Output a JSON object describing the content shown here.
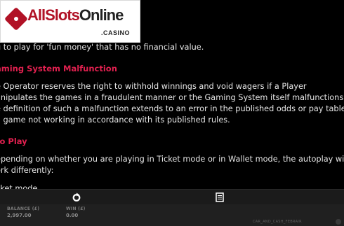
{
  "logo": {
    "text_main": "AllSlots",
    "text_accent": "Online",
    "subtitle": ".CASINO"
  },
  "content": {
    "intro_line": "u to play for 'fun money' that has no financial value.",
    "malfunction": {
      "heading": "aming System Malfunction",
      "lines": [
        "e Operator reserves the right to withhold winnings and void wagers if a Player",
        "anipulates the games in a fraudulent manner or the Gaming System itself malfunctions.",
        "e definition of such a malfunction extends to an error in the published odds or pay table",
        "a game not working in accordance with its published rules."
      ]
    },
    "autoplay": {
      "heading": "to Play",
      "lines": [
        "epending on whether you are playing in Ticket mode or in Wallet mode, the autoplay will",
        "ork differently:"
      ],
      "ticket_mode_link": "cket mode"
    }
  },
  "toolbar": {
    "icons": [
      "refresh-icon",
      "document-icon"
    ]
  },
  "status": {
    "balance_label": "BALANCE (£)",
    "balance_value": "2,997.00",
    "win_label": "WIN (£)",
    "win_value": "0.00",
    "game_id": "CAR_AND_CASH_FEBRAIR"
  },
  "colors": {
    "heading": "#e0204f",
    "background": "#000000",
    "text": "#e6e6e6",
    "brand": "#b11226"
  }
}
